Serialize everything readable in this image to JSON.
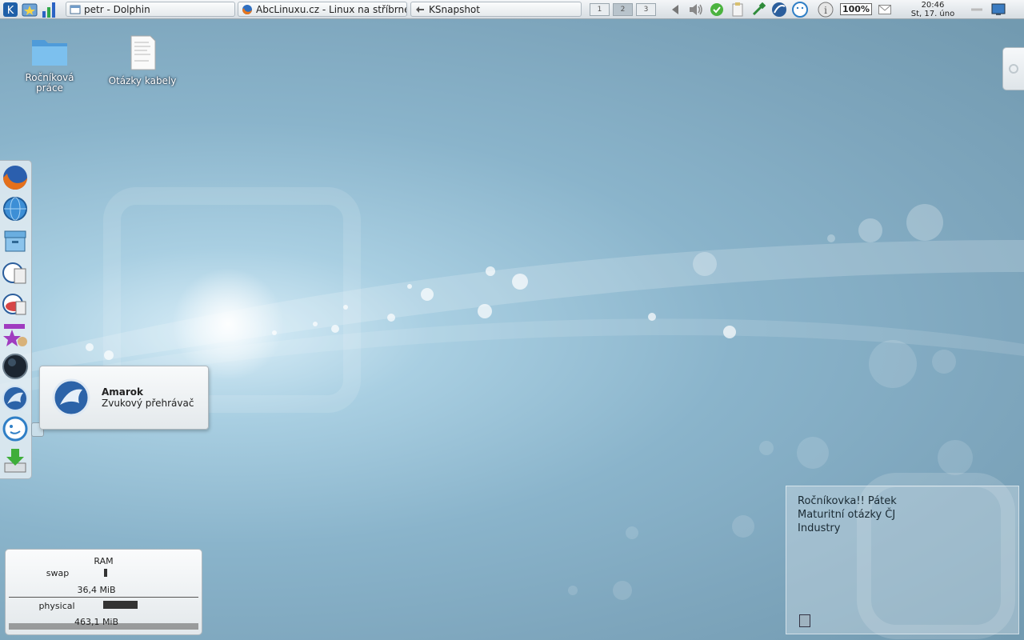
{
  "panel": {
    "tasks": [
      {
        "label": "petr - Dolphin",
        "icon": "folder-window-icon"
      },
      {
        "label": "AbcLinuxu.cz - Linux na stříbrném",
        "icon": "firefox-icon"
      },
      {
        "label": "KSnapshot",
        "icon": "ksnapshot-icon"
      }
    ],
    "pager": [
      "1",
      "2",
      "3"
    ],
    "battery": "100%",
    "clock": {
      "time": "20:46",
      "date": "St, 17. úno"
    }
  },
  "desktop": {
    "icons": [
      {
        "label": "Ročníková práce",
        "icon": "folder-icon"
      },
      {
        "label": "Otázky kabely",
        "icon": "document-icon"
      }
    ]
  },
  "dock": {
    "items": [
      "firefox-icon",
      "network-globe-icon",
      "archive-box-icon",
      "office-writer-icon",
      "office-calc-icon",
      "star-paint-icon",
      "dark-globe-icon",
      "amarok-icon",
      "chat-bubble-icon",
      "download-icon"
    ]
  },
  "tooltip": {
    "title": "Amarok",
    "subtitle": "Zvukový přehrávač"
  },
  "ram": {
    "title": "RAM",
    "swap_label": "swap",
    "swap_value": "36,4 MiB",
    "physical_label": "physical",
    "physical_value": "463,1 MiB"
  },
  "note": {
    "lines": [
      "Ročníkovka!! Pátek",
      "Maturitní otázky ČJ",
      "Industry"
    ]
  },
  "colors": {
    "panel": "#dfe4e8",
    "wallpaper": "#8ab4cb"
  }
}
